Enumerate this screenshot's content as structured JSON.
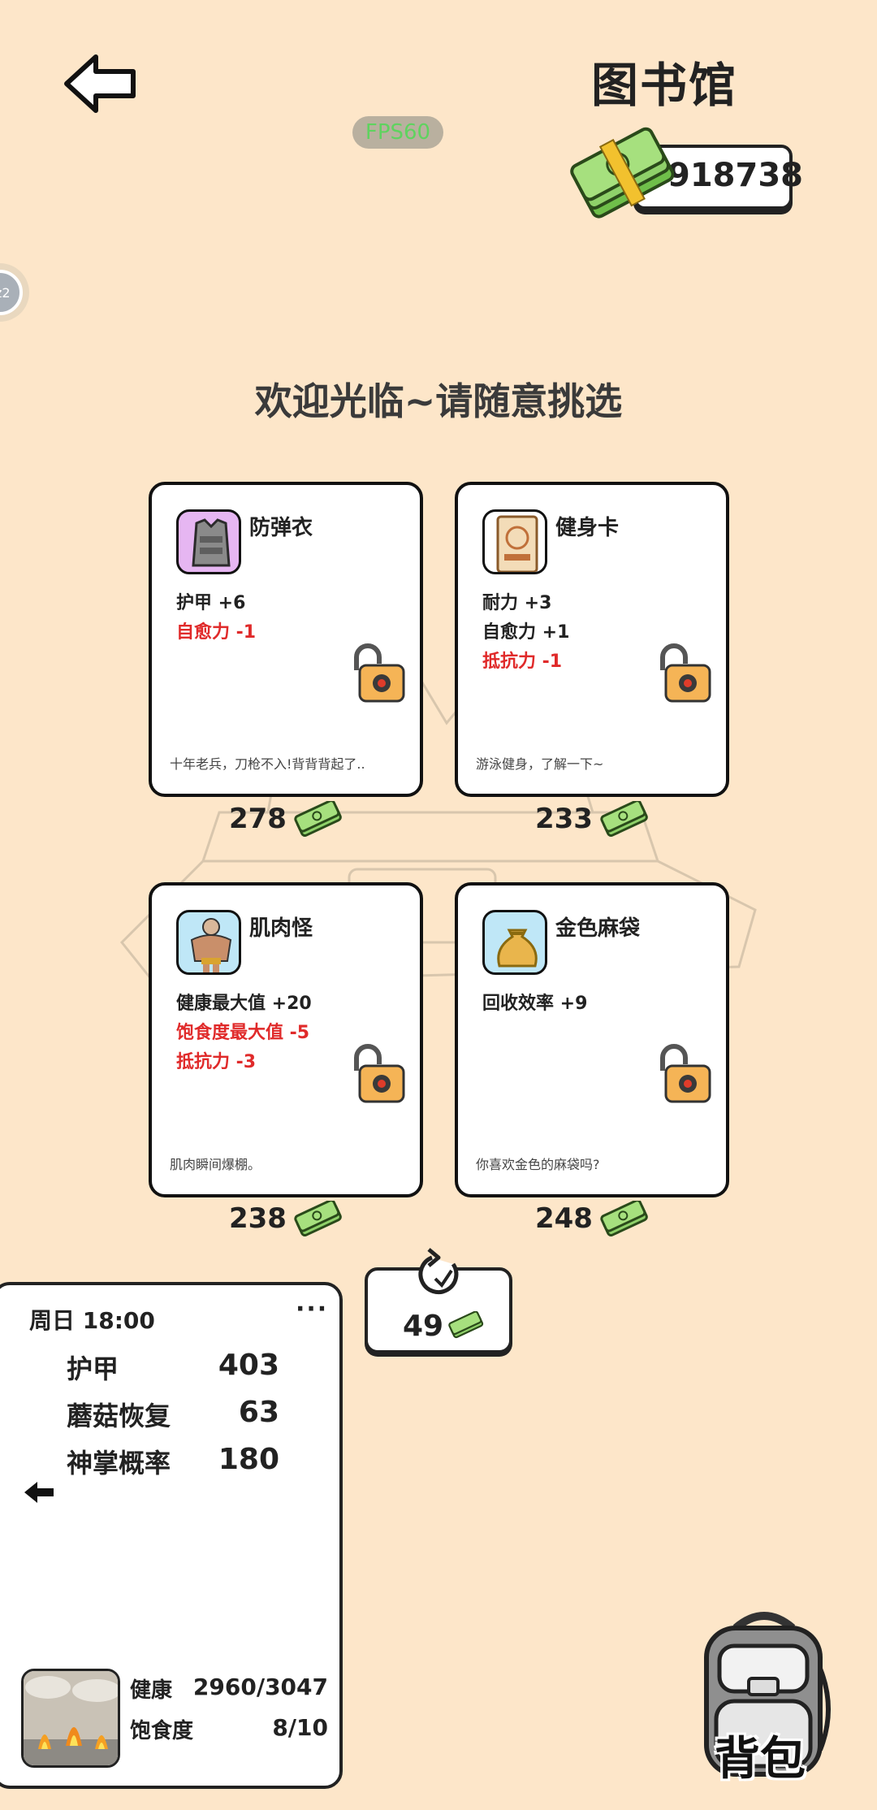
{
  "header": {
    "title": "图书馆",
    "fps": "FPS60",
    "money": "918738"
  },
  "welcome": "欢迎光临~请随意挑选",
  "cards": [
    {
      "name": "防弹衣",
      "stats": [
        {
          "text": "护甲 +6",
          "tone": "pos"
        },
        {
          "text": "自愈力 -1",
          "tone": "neg"
        }
      ],
      "desc": "十年老兵，刀枪不入!背背背起了..",
      "price": "278",
      "icon": "vest-icon"
    },
    {
      "name": "健身卡",
      "stats": [
        {
          "text": "耐力 +3",
          "tone": "pos"
        },
        {
          "text": "自愈力 +1",
          "tone": "pos"
        },
        {
          "text": "抵抗力 -1",
          "tone": "neg"
        }
      ],
      "desc": "游泳健身，了解一下~",
      "price": "233",
      "icon": "gym-card-icon"
    },
    {
      "name": "肌肉怪",
      "stats": [
        {
          "text": "健康最大值 +20",
          "tone": "pos"
        },
        {
          "text": "饱食度最大值 -5",
          "tone": "neg"
        },
        {
          "text": "抵抗力 -3",
          "tone": "neg"
        }
      ],
      "desc": "肌肉瞬间爆棚。",
      "price": "238",
      "icon": "muscle-man-icon"
    },
    {
      "name": "金色麻袋",
      "stats": [
        {
          "text": "回收效率 +9",
          "tone": "pos"
        }
      ],
      "desc": "你喜欢金色的麻袋吗?",
      "price": "248",
      "icon": "gold-sack-icon"
    }
  ],
  "refresh": {
    "cost": "49"
  },
  "status": {
    "time": "周日 18:00",
    "more": "···",
    "rows": [
      {
        "label": "护甲",
        "value": "403"
      },
      {
        "label": "蘑菇恢复",
        "value": "63"
      },
      {
        "label": "神掌概率",
        "value": "180"
      }
    ],
    "health": {
      "label": "健康",
      "value": "2960/3047"
    },
    "satiety": {
      "label": "饱食度",
      "value": "8/10"
    }
  },
  "backpack": {
    "label": "背包"
  },
  "colors": {
    "background": "#fde6c9",
    "negative": "#e02a2a",
    "money_green": "#8fd16a"
  }
}
